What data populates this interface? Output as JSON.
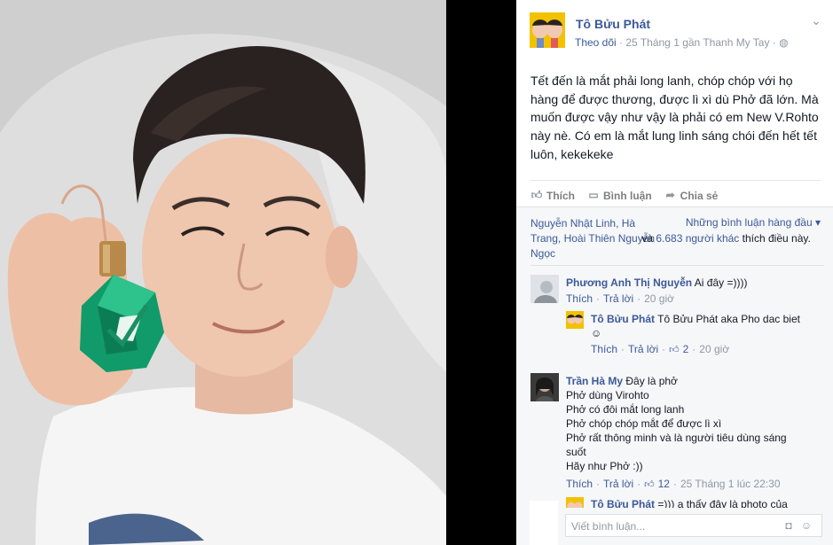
{
  "post": {
    "author": "Tô Bửu Phát",
    "follow": "Theo dõi",
    "meta": " · 25 Tháng 1 gần Thanh My Tay · ",
    "text": "Tết đến là mắt phải long lanh, chóp chóp với họ hàng để được thương, được lì xì dù Phở đã lớn. Mà muốn được vậy như vậy là phải có em New V.Rohto này nè. Có em là mắt lung linh sáng chói đến hết tết luôn, kekekeke"
  },
  "actions": {
    "like": "Thích",
    "comment": "Bình luận",
    "share": "Chia sẻ"
  },
  "likes": {
    "names": "Nguyễn Nhật Linh, Hà Trang, Hoài Thiên Nguyễn Ngọc",
    "connector": " và ",
    "others": "6.683 người khác",
    "suffix": " thích điều này.",
    "top_comments": "Những bình luận hàng đầu ▾"
  },
  "comments": [
    {
      "name": "Phương Anh Thị Nguyễn",
      "text": " Ai đây =))))",
      "like": "Thích",
      "reply": "Trả lời",
      "time": "20 giờ"
    },
    {
      "name": "Tô Bửu Phát",
      "text": " Tô Bửu Phát aka Pho dac biet ☺",
      "like": "Thích",
      "reply": "Trả lời",
      "likes_count": "2",
      "time": "20 giờ"
    },
    {
      "name": "Trần Hà My",
      "line1": " Đây là phở",
      "line2": "Phở dùng Virohto",
      "line3": "Phở có đôi mắt long lanh",
      "line4": "Phở chóp chóp mắt để được lì xì",
      "line5": "Phở rất thông minh và là người tiêu dùng sáng suốt",
      "line6": "Hãy như Phở :))",
      "like": "Thích",
      "reply": "Trả lời",
      "likes_count": "12",
      "time": "25 Tháng 1 lúc 22:30"
    },
    {
      "name": "Tô Bửu Phát",
      "text": " =))) a thấy đây là photo của"
    }
  ],
  "composer": {
    "placeholder": "Viết bình luận..."
  }
}
